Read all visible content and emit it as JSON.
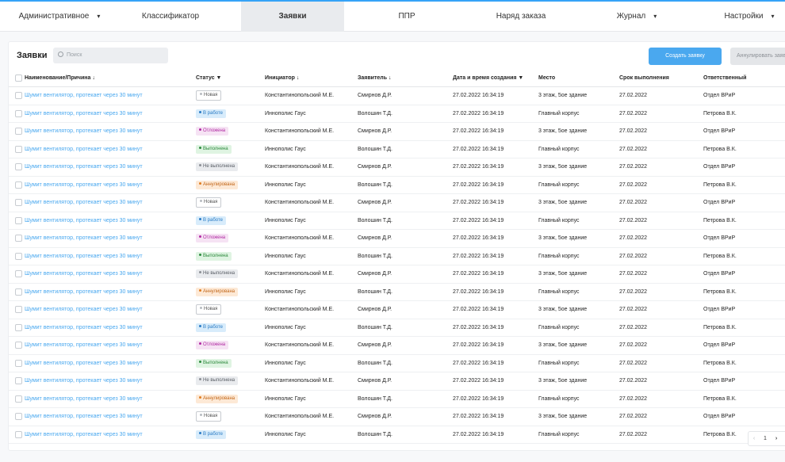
{
  "nav": {
    "items": [
      {
        "label": "Административное",
        "dropdown": true
      },
      {
        "label": "Классификатор",
        "dropdown": false
      },
      {
        "label": "Заявки",
        "dropdown": false,
        "active": true
      },
      {
        "label": "ППР",
        "dropdown": false
      },
      {
        "label": "Наряд заказа",
        "dropdown": false
      },
      {
        "label": "Журнал",
        "dropdown": true
      },
      {
        "label": "Настройки",
        "dropdown": true
      }
    ],
    "chevron": "▾"
  },
  "panel": {
    "title": "Заявки",
    "search_placeholder": "Поиск",
    "create_button": "Создать заявку",
    "cancel_button": "Аннулировать заявку"
  },
  "table": {
    "columns": [
      "Наименование/Причина ↓",
      "Статус ▼",
      "Инициатор ↓",
      "Заявитель ↓",
      "Дата и время создания ▼",
      "Место",
      "Срок выполнения",
      "Ответственный"
    ],
    "rows": [
      {
        "name": "Шумит вентилятор, протекает через 30 минут",
        "status": "Новая",
        "status_kind": "new",
        "initiator": "Константинопольский М.Е.",
        "applicant": "Смирнов Д.Р.",
        "created": "27.02.2022 16:34:19",
        "place": "3 этаж, 5ое здание",
        "deadline": "27.02.2022",
        "responsible": "Отдел ВРиР"
      },
      {
        "name": "Шумит вентилятор, протекает через 30 минут",
        "status": "В работе",
        "status_kind": "work",
        "initiator": "Иннополис Гаус",
        "applicant": "Волошин Т.Д.",
        "created": "27.02.2022 16:34:19",
        "place": "Главный корпус",
        "deadline": "27.02.2022",
        "responsible": "Петрова В.К."
      },
      {
        "name": "Шумит вентилятор, протекает через 30 минут",
        "status": "Отложена",
        "status_kind": "delay",
        "initiator": "Константинопольский М.Е.",
        "applicant": "Смирнов Д.Р.",
        "created": "27.02.2022 16:34:19",
        "place": "3 этаж, 5ое здание",
        "deadline": "27.02.2022",
        "responsible": "Отдел ВРиР"
      },
      {
        "name": "Шумит вентилятор, протекает через 30 минут",
        "status": "Выполнена",
        "status_kind": "done",
        "initiator": "Иннополис Гаус",
        "applicant": "Волошин Т.Д.",
        "created": "27.02.2022 16:34:19",
        "place": "Главный корпус",
        "deadline": "27.02.2022",
        "responsible": "Петрова В.К."
      },
      {
        "name": "Шумит вентилятор, протекает через 30 минут",
        "status": "Не выполнена",
        "status_kind": "fail",
        "initiator": "Константинопольский М.Е.",
        "applicant": "Смирнов Д.Р.",
        "created": "27.02.2022 16:34:19",
        "place": "3 этаж, 5ое здание",
        "deadline": "27.02.2022",
        "responsible": "Отдел ВРиР"
      },
      {
        "name": "Шумит вентилятор, протекает через 30 минут",
        "status": "Аннулирована",
        "status_kind": "cancel",
        "initiator": "Иннополис Гаус",
        "applicant": "Волошин Т.Д.",
        "created": "27.02.2022 16:34:19",
        "place": "Главный корпус",
        "deadline": "27.02.2022",
        "responsible": "Петрова В.К."
      },
      {
        "name": "Шумит вентилятор, протекает через 30 минут",
        "status": "Новая",
        "status_kind": "new",
        "initiator": "Константинопольский М.Е.",
        "applicant": "Смирнов Д.Р.",
        "created": "27.02.2022 16:34:19",
        "place": "3 этаж, 5ое здание",
        "deadline": "27.02.2022",
        "responsible": "Отдел ВРиР"
      },
      {
        "name": "Шумит вентилятор, протекает через 30 минут",
        "status": "В работе",
        "status_kind": "work",
        "initiator": "Иннополис Гаус",
        "applicant": "Волошин Т.Д.",
        "created": "27.02.2022 16:34:19",
        "place": "Главный корпус",
        "deadline": "27.02.2022",
        "responsible": "Петрова В.К."
      },
      {
        "name": "Шумит вентилятор, протекает через 30 минут",
        "status": "Отложена",
        "status_kind": "delay",
        "initiator": "Константинопольский М.Е.",
        "applicant": "Смирнов Д.Р.",
        "created": "27.02.2022 16:34:19",
        "place": "3 этаж, 5ое здание",
        "deadline": "27.02.2022",
        "responsible": "Отдел ВРиР"
      },
      {
        "name": "Шумит вентилятор, протекает через 30 минут",
        "status": "Выполнена",
        "status_kind": "done",
        "initiator": "Иннополис Гаус",
        "applicant": "Волошин Т.Д.",
        "created": "27.02.2022 16:34:19",
        "place": "Главный корпус",
        "deadline": "27.02.2022",
        "responsible": "Петрова В.К."
      },
      {
        "name": "Шумит вентилятор, протекает через 30 минут",
        "status": "Не выполнена",
        "status_kind": "fail",
        "initiator": "Константинопольский М.Е.",
        "applicant": "Смирнов Д.Р.",
        "created": "27.02.2022 16:34:19",
        "place": "3 этаж, 5ое здание",
        "deadline": "27.02.2022",
        "responsible": "Отдел ВРиР"
      },
      {
        "name": "Шумит вентилятор, протекает через 30 минут",
        "status": "Аннулирована",
        "status_kind": "cancel",
        "initiator": "Иннополис Гаус",
        "applicant": "Волошин Т.Д.",
        "created": "27.02.2022 16:34:19",
        "place": "Главный корпус",
        "deadline": "27.02.2022",
        "responsible": "Петрова В.К."
      },
      {
        "name": "Шумит вентилятор, протекает через 30 минут",
        "status": "Новая",
        "status_kind": "new",
        "initiator": "Константинопольский М.Е.",
        "applicant": "Смирнов Д.Р.",
        "created": "27.02.2022 16:34:19",
        "place": "3 этаж, 5ое здание",
        "deadline": "27.02.2022",
        "responsible": "Отдел ВРиР"
      },
      {
        "name": "Шумит вентилятор, протекает через 30 минут",
        "status": "В работе",
        "status_kind": "work",
        "initiator": "Иннополис Гаус",
        "applicant": "Волошин Т.Д.",
        "created": "27.02.2022 16:34:19",
        "place": "Главный корпус",
        "deadline": "27.02.2022",
        "responsible": "Петрова В.К."
      },
      {
        "name": "Шумит вентилятор, протекает через 30 минут",
        "status": "Отложена",
        "status_kind": "delay",
        "initiator": "Константинопольский М.Е.",
        "applicant": "Смирнов Д.Р.",
        "created": "27.02.2022 16:34:19",
        "place": "3 этаж, 5ое здание",
        "deadline": "27.02.2022",
        "responsible": "Отдел ВРиР"
      },
      {
        "name": "Шумит вентилятор, протекает через 30 минут",
        "status": "Выполнена",
        "status_kind": "done",
        "initiator": "Иннополис Гаус",
        "applicant": "Волошин Т.Д.",
        "created": "27.02.2022 16:34:19",
        "place": "Главный корпус",
        "deadline": "27.02.2022",
        "responsible": "Петрова В.К."
      },
      {
        "name": "Шумит вентилятор, протекает через 30 минут",
        "status": "Не выполнена",
        "status_kind": "fail",
        "initiator": "Константинопольский М.Е.",
        "applicant": "Смирнов Д.Р.",
        "created": "27.02.2022 16:34:19",
        "place": "3 этаж, 5ое здание",
        "deadline": "27.02.2022",
        "responsible": "Отдел ВРиР"
      },
      {
        "name": "Шумит вентилятор, протекает через 30 минут",
        "status": "Аннулирована",
        "status_kind": "cancel",
        "initiator": "Иннополис Гаус",
        "applicant": "Волошин Т.Д.",
        "created": "27.02.2022 16:34:19",
        "place": "Главный корпус",
        "deadline": "27.02.2022",
        "responsible": "Петрова В.К."
      },
      {
        "name": "Шумит вентилятор, протекает через 30 минут",
        "status": "Новая",
        "status_kind": "new",
        "initiator": "Константинопольский М.Е.",
        "applicant": "Смирнов Д.Р.",
        "created": "27.02.2022 16:34:19",
        "place": "3 этаж, 5ое здание",
        "deadline": "27.02.2022",
        "responsible": "Отдел ВРиР"
      },
      {
        "name": "Шумит вентилятор, протекает через 30 минут",
        "status": "В работе",
        "status_kind": "work",
        "initiator": "Иннополис Гаус",
        "applicant": "Волошин Т.Д.",
        "created": "27.02.2022 16:34:19",
        "place": "Главный корпус",
        "deadline": "27.02.2022",
        "responsible": "Петрова В.К."
      }
    ]
  },
  "pagination": {
    "prev": "‹",
    "page": "1",
    "next": "›"
  },
  "colors": {
    "accent": "#4aa8ef",
    "topbar_border": "#36a3f7",
    "active_tab": "#e9ebee"
  }
}
